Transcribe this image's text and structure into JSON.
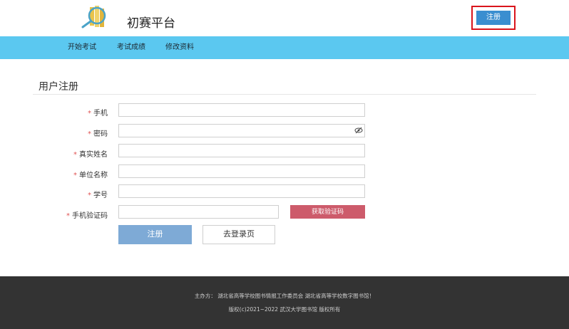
{
  "header": {
    "title": "初赛平台",
    "register_label": "注册"
  },
  "nav": {
    "items": [
      {
        "label": "开始考试"
      },
      {
        "label": "考试成绩"
      },
      {
        "label": "修改资料"
      }
    ]
  },
  "form": {
    "title": "用户注册",
    "required_mark": "*",
    "fields": [
      {
        "label": "手机",
        "value": ""
      },
      {
        "label": "密码",
        "value": ""
      },
      {
        "label": "真实姓名",
        "value": ""
      },
      {
        "label": "单位名称",
        "value": ""
      },
      {
        "label": "学号",
        "value": ""
      },
      {
        "label": "手机验证码",
        "value": ""
      }
    ],
    "get_code_label": "获取验证码",
    "submit_label": "注册",
    "login_label": "去登录页"
  },
  "footer": {
    "organizer": "主办方： 湖北省高等学校图书情报工作委员会 湖北省高等学校数字图书馆！",
    "copyright": "版权(c)2021~2022 武汉大学图书馆 版权所有"
  },
  "colors": {
    "nav_bg": "#5bc8f0",
    "register_button": "#3a8ed0",
    "highlight_border": "#d9141c",
    "code_button": "#cd5b6b",
    "submit_button": "#7eaad6",
    "footer_bg": "#333333"
  },
  "icons": [
    "logo-icon",
    "eye-icon"
  ]
}
